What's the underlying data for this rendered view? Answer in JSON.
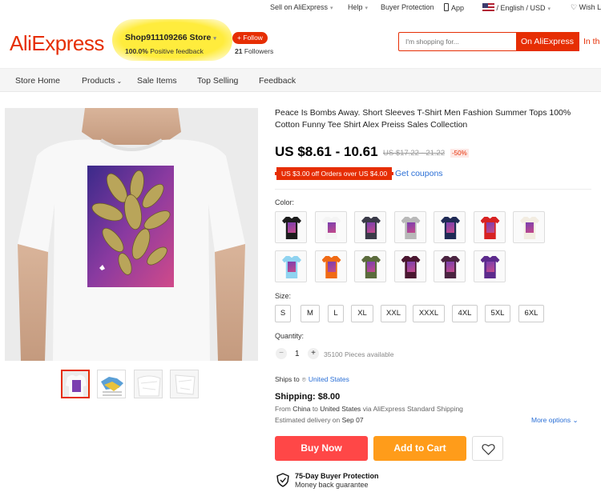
{
  "topbar": {
    "sell": "Sell on AliExpress",
    "help": "Help",
    "buyer_protection": "Buyer Protection",
    "app": "App",
    "language_currency": "/ English / USD",
    "wishlist": "Wish L"
  },
  "header": {
    "logo": "AliExpress",
    "store_name": "Shop911109266 Store",
    "feedback_pct": "100.0%",
    "feedback_label": "Positive feedback",
    "follow_label": "+ Follow",
    "followers_count": "21",
    "followers_label": "Followers",
    "search_placeholder": "I'm shopping for...",
    "search_btn_aliexpress": "On AliExpress",
    "search_btn_store": "In th"
  },
  "nav": {
    "items": [
      "Store Home",
      "Products",
      "Sale Items",
      "Top Selling",
      "Feedback"
    ]
  },
  "product": {
    "title": "Peace Is Bombs Away. Short Sleeves T-Shirt Men Fashion Summer Tops 100% Cotton Funny Tee Shirt Alex Preiss Sales Collection",
    "price": "US $8.61 - 10.61",
    "old_price": "US $17.22 - 21.22",
    "discount": "-50%",
    "coupon": "US $3.00 off Orders over US $4.00",
    "get_coupons": "Get coupons",
    "color_label": "Color:",
    "colors": [
      "#1c1c1c",
      "#f4f4f4",
      "#3a3a48",
      "#b8b8b8",
      "#1f2a55",
      "#d72222",
      "#f2ece1",
      "#8fd3f0",
      "#f06a14",
      "#5b6b3c",
      "#4a1630",
      "#4a2340",
      "#5c2a8c"
    ],
    "size_label": "Size:",
    "sizes": [
      "S",
      "M",
      "L",
      "XL",
      "XXL",
      "XXXL",
      "4XL",
      "5XL",
      "6XL"
    ],
    "quantity_label": "Quantity:",
    "quantity": "1",
    "qty_minus": "−",
    "qty_plus": "+",
    "available": "35100 Pieces available"
  },
  "shipping": {
    "ships_to_label": "Ships to",
    "country": "United States",
    "cost": "Shipping: $8.00",
    "from_label": "From",
    "from_country": "China",
    "to_label": "to",
    "to_country": "United States",
    "via": "via AliExpress Standard Shipping",
    "delivery_label": "Estimated delivery on",
    "delivery_date": "Sep 07",
    "more_options": "More options"
  },
  "actions": {
    "buy_now": "Buy Now",
    "add_to_cart": "Add to Cart"
  },
  "protection": {
    "title": "75-Day Buyer Protection",
    "subtitle": "Money back guarantee"
  },
  "colors": {
    "accent": "#e62e04",
    "buy_now": "#ff4747",
    "add_to_cart": "#ff9c1a",
    "link": "#2a6fd6",
    "highlight": "#ffec3d"
  }
}
